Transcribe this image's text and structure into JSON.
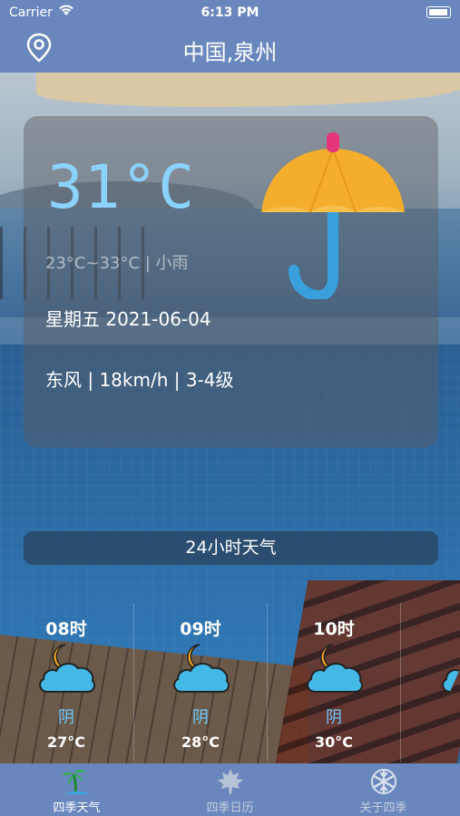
{
  "status_bar": {
    "carrier": "Carrier",
    "time": "6:13 PM"
  },
  "nav": {
    "title": "中国,泉州",
    "location_icon": "map-pin-icon"
  },
  "current": {
    "temperature": "31°C",
    "range_condition": "23°C~33°C | 小雨",
    "date": "星期五 2021-06-04",
    "wind": "东风 |  18km/h | 3-4级",
    "icon": "umbrella-icon"
  },
  "forecast_24h": {
    "label": "24小时天气",
    "hours": [
      {
        "time": "08时",
        "desc": "阴",
        "temp": "27°C",
        "icon": "cloudy-night-icon"
      },
      {
        "time": "09时",
        "desc": "阴",
        "temp": "28°C",
        "icon": "cloudy-night-icon"
      },
      {
        "time": "10时",
        "desc": "阴",
        "temp": "30°C",
        "icon": "cloudy-night-icon"
      }
    ]
  },
  "tabs": [
    {
      "label": "四季天气",
      "icon": "palm-tree-icon",
      "active": true
    },
    {
      "label": "四季日历",
      "icon": "maple-leaf-icon",
      "active": false
    },
    {
      "label": "关于四季",
      "icon": "snowflake-icon",
      "active": false
    }
  ],
  "colors": {
    "bar": "#6a87bd",
    "temp": "#8bd3ff",
    "cloud": "#45b9e6",
    "moon": "#f6a623"
  }
}
